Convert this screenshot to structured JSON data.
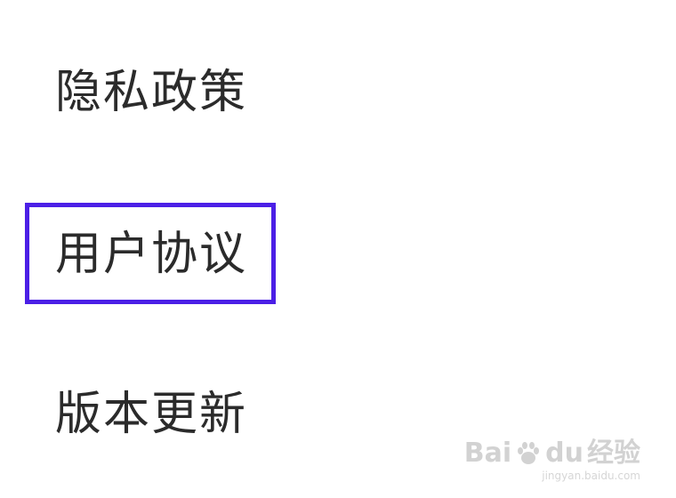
{
  "menu": {
    "items": [
      {
        "label": "隐私政策"
      },
      {
        "label": "用户协议",
        "highlighted": true
      },
      {
        "label": "版本更新"
      }
    ]
  },
  "highlight_color": "#4b1fe6",
  "watermark": {
    "brand_left": "Bai",
    "brand_right": "du",
    "brand_suffix": "经验",
    "url": "jingyan.baidu.com"
  }
}
